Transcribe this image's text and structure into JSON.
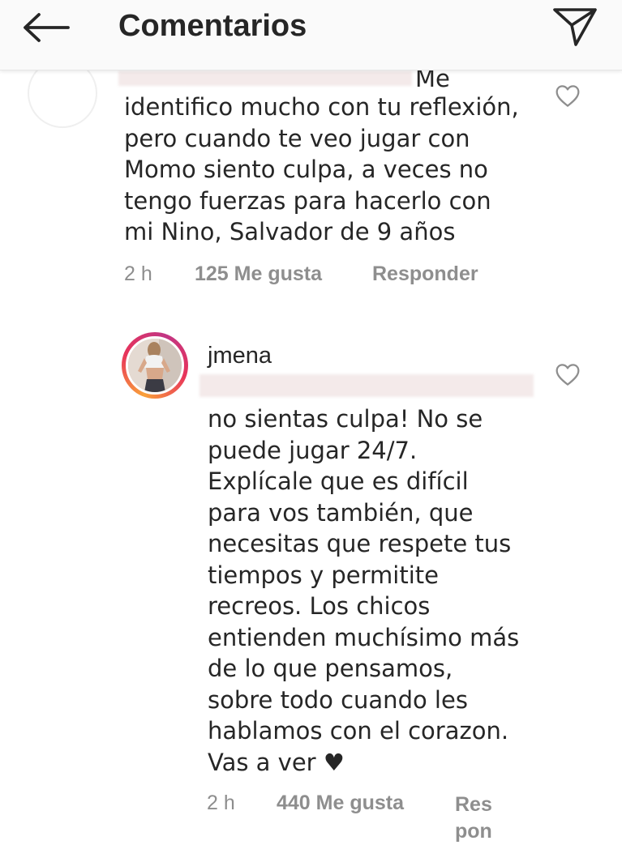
{
  "header": {
    "title": "Comentarios",
    "back_icon": "arrow-left-icon",
    "send_icon": "paper-plane-icon"
  },
  "comments": [
    {
      "username": "",
      "text_partial_first_line": "Me",
      "text": "identifico mucho con tu reflexión,\npero cuando te veo jugar con\nMomo siento culpa, a veces no\ntengo fuerzas para hacerlo con\nmi Nino, Salvador de 9 años",
      "time": "2 h",
      "likes": "125 Me gusta",
      "reply_label": "Responder",
      "like_icon": "heart-outline-icon"
    },
    {
      "username": "jmena",
      "text": "no sientas culpa! No se\npuede jugar 24/7.\nExplícale que es difícil\npara vos también, que\nnecesitas que respete tus\ntiempos y permitite\nrecreos. Los chicos\nentienden muchísimo más\nde lo que pensamos,\nsobre todo cuando les\nhablamos con el corazon.\nVas a ver ♥",
      "time": "2 h",
      "likes": "440 Me gusta",
      "reply_label_line1": "Res",
      "reply_label_line2": "pon",
      "like_icon": "heart-outline-icon"
    }
  ],
  "colors": {
    "text": "#262626",
    "meta": "#8e8e8e",
    "header_bg": "#fafafa",
    "story_ring_start": "#f9a13a",
    "story_ring_end": "#c13584"
  }
}
